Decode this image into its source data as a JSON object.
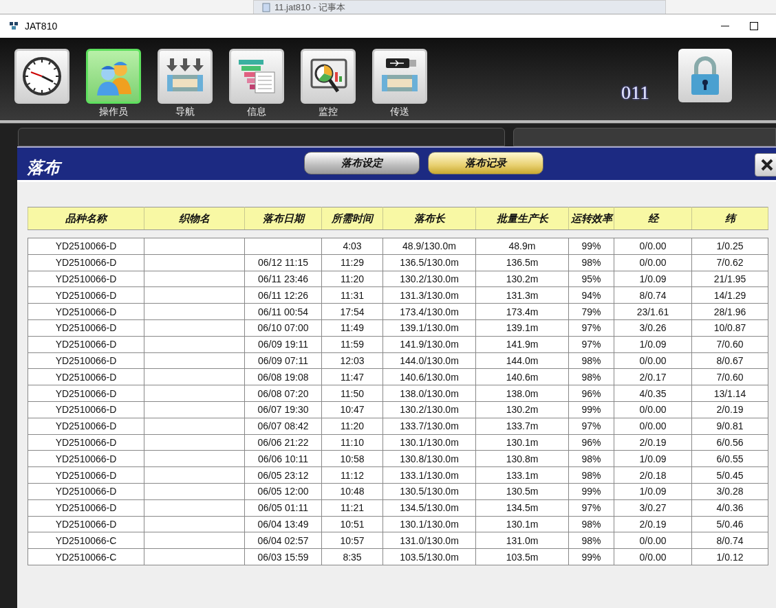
{
  "background_window": {
    "title": "11.jat810 - 记事本"
  },
  "window": {
    "title": "JAT810"
  },
  "toolbar": {
    "items": [
      {
        "kind": "clock",
        "selected": false
      },
      {
        "kind": "operators",
        "label": "操作员",
        "selected": true
      },
      {
        "kind": "navigation",
        "label": "导航",
        "selected": false
      },
      {
        "kind": "info",
        "label": "信息",
        "selected": false
      },
      {
        "kind": "monitor",
        "label": "监控",
        "selected": false
      },
      {
        "kind": "transfer",
        "label": "传送",
        "selected": false
      }
    ],
    "counter": "011"
  },
  "dialog": {
    "title": "落布",
    "tabs": [
      {
        "label": "落布设定",
        "selected": false
      },
      {
        "label": "落布记录",
        "selected": true
      }
    ],
    "table": {
      "columns": [
        "品种名称",
        "织物名",
        "落布日期",
        "所需时间",
        "落布长",
        "批量生产长",
        "运转效率",
        "经",
        "纬"
      ],
      "rows": [
        [
          "YD2510066-D",
          null,
          null,
          "4:03",
          "48.9/130.0m",
          "48.9m",
          "99%",
          "0/0.00",
          "1/0.25"
        ],
        [
          "YD2510066-D",
          null,
          "06/12 11:15",
          "11:29",
          "136.5/130.0m",
          "136.5m",
          "98%",
          "0/0.00",
          "7/0.62"
        ],
        [
          "YD2510066-D",
          null,
          "06/11 23:46",
          "11:20",
          "130.2/130.0m",
          "130.2m",
          "95%",
          "1/0.09",
          "21/1.95"
        ],
        [
          "YD2510066-D",
          null,
          "06/11 12:26",
          "11:31",
          "131.3/130.0m",
          "131.3m",
          "94%",
          "8/0.74",
          "14/1.29"
        ],
        [
          "YD2510066-D",
          null,
          "06/11 00:54",
          "17:54",
          "173.4/130.0m",
          "173.4m",
          "79%",
          "23/1.61",
          "28/1.96"
        ],
        [
          "YD2510066-D",
          null,
          "06/10 07:00",
          "11:49",
          "139.1/130.0m",
          "139.1m",
          "97%",
          "3/0.26",
          "10/0.87"
        ],
        [
          "YD2510066-D",
          null,
          "06/09 19:11",
          "11:59",
          "141.9/130.0m",
          "141.9m",
          "97%",
          "1/0.09",
          "7/0.60"
        ],
        [
          "YD2510066-D",
          null,
          "06/09 07:11",
          "12:03",
          "144.0/130.0m",
          "144.0m",
          "98%",
          "0/0.00",
          "8/0.67"
        ],
        [
          "YD2510066-D",
          null,
          "06/08 19:08",
          "11:47",
          "140.6/130.0m",
          "140.6m",
          "98%",
          "2/0.17",
          "7/0.60"
        ],
        [
          "YD2510066-D",
          null,
          "06/08 07:20",
          "11:50",
          "138.0/130.0m",
          "138.0m",
          "96%",
          "4/0.35",
          "13/1.14"
        ],
        [
          "YD2510066-D",
          null,
          "06/07 19:30",
          "10:47",
          "130.2/130.0m",
          "130.2m",
          "99%",
          "0/0.00",
          "2/0.19"
        ],
        [
          "YD2510066-D",
          null,
          "06/07 08:42",
          "11:20",
          "133.7/130.0m",
          "133.7m",
          "97%",
          "0/0.00",
          "9/0.81"
        ],
        [
          "YD2510066-D",
          null,
          "06/06 21:22",
          "11:10",
          "130.1/130.0m",
          "130.1m",
          "96%",
          "2/0.19",
          "6/0.56"
        ],
        [
          "YD2510066-D",
          null,
          "06/06 10:11",
          "10:58",
          "130.8/130.0m",
          "130.8m",
          "98%",
          "1/0.09",
          "6/0.55"
        ],
        [
          "YD2510066-D",
          null,
          "06/05 23:12",
          "11:12",
          "133.1/130.0m",
          "133.1m",
          "98%",
          "2/0.18",
          "5/0.45"
        ],
        [
          "YD2510066-D",
          null,
          "06/05 12:00",
          "10:48",
          "130.5/130.0m",
          "130.5m",
          "99%",
          "1/0.09",
          "3/0.28"
        ],
        [
          "YD2510066-D",
          null,
          "06/05 01:11",
          "11:21",
          "134.5/130.0m",
          "134.5m",
          "97%",
          "3/0.27",
          "4/0.36"
        ],
        [
          "YD2510066-D",
          null,
          "06/04 13:49",
          "10:51",
          "130.1/130.0m",
          "130.1m",
          "98%",
          "2/0.19",
          "5/0.46"
        ],
        [
          "YD2510066-C",
          null,
          "06/04 02:57",
          "10:57",
          "131.0/130.0m",
          "131.0m",
          "98%",
          "0/0.00",
          "8/0.74"
        ],
        [
          "YD2510066-C",
          null,
          "06/03 15:59",
          "8:35",
          "103.5/130.0m",
          "103.5m",
          "99%",
          "0/0.00",
          "1/0.12"
        ]
      ]
    }
  }
}
